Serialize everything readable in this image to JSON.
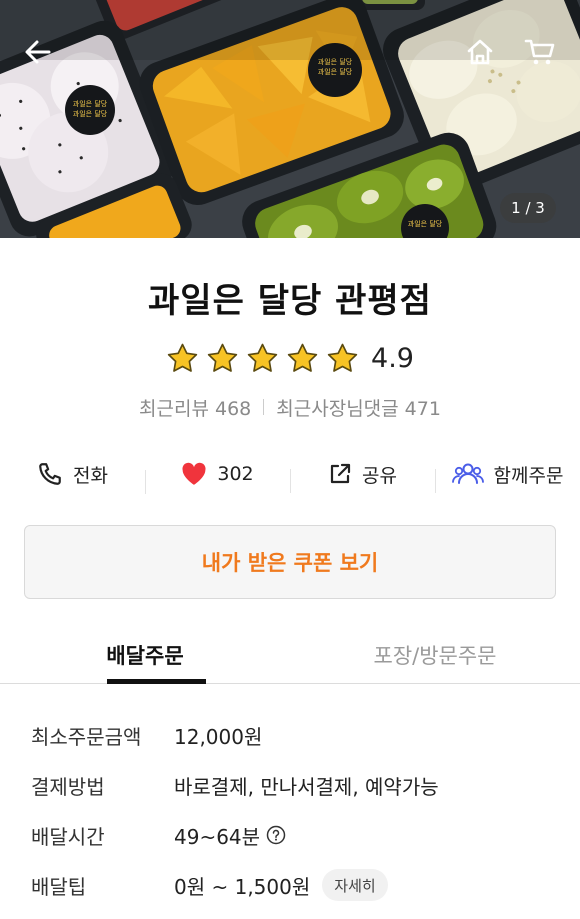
{
  "hero": {
    "counter": "1 / 3",
    "label_text": "과일은 달당"
  },
  "store": {
    "name": "과일은 달당 관평점",
    "rating": "4.9",
    "star_count": 5,
    "recent_reviews": "최근리뷰 468",
    "owner_replies": "최근사장님댓글 471"
  },
  "actions": {
    "call_label": "전화",
    "like_count": "302",
    "share_label": "공유",
    "group_order_label": "함께주문"
  },
  "coupon": {
    "label": "내가 받은 쿠폰 보기"
  },
  "tabs": [
    {
      "label": "배달주문"
    },
    {
      "label": "포장/방문주문"
    }
  ],
  "info": {
    "min_order_label": "최소주문금액",
    "min_order_value": "12,000원",
    "payment_label": "결제방법",
    "payment_value": "바로결제, 만나서결제, 예약가능",
    "delivery_time_label": "배달시간",
    "delivery_time_value": "49~64분",
    "delivery_tip_label": "배달팁",
    "delivery_tip_value": "0원 ~ 1,500원",
    "detail_button": "자세히"
  },
  "colors": {
    "accent": "#f07a1e",
    "heart": "#f0343c",
    "group_icon": "#4a5de8",
    "star": "#f7c325"
  }
}
